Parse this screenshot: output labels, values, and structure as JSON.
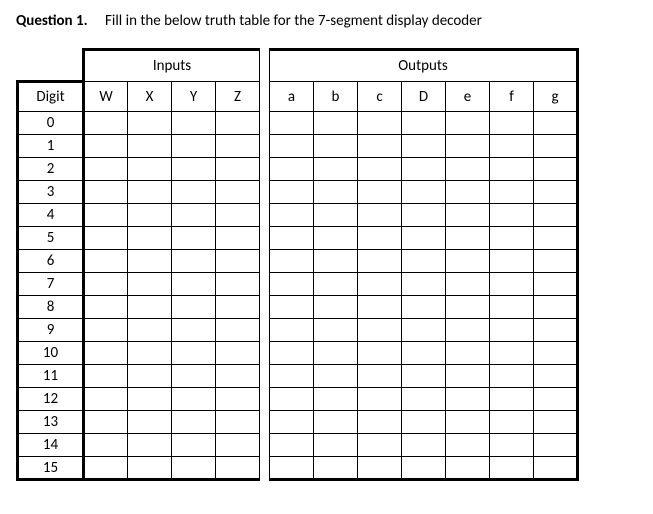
{
  "question": {
    "label": "Question 1.",
    "text": "Fill in the below truth table for the 7-segment display decoder"
  },
  "table": {
    "groups": {
      "inputs": "Inputs",
      "outputs": "Outputs"
    },
    "digit_header": "Digit",
    "input_headers": [
      "W",
      "X",
      "Y",
      "Z"
    ],
    "output_headers": [
      "a",
      "b",
      "c",
      "D",
      "e",
      "f",
      "g"
    ],
    "rows": [
      {
        "digit": "0",
        "inputs": [
          "",
          "",
          "",
          ""
        ],
        "outputs": [
          "",
          "",
          "",
          "",
          "",
          "",
          ""
        ]
      },
      {
        "digit": "1",
        "inputs": [
          "",
          "",
          "",
          ""
        ],
        "outputs": [
          "",
          "",
          "",
          "",
          "",
          "",
          ""
        ]
      },
      {
        "digit": "2",
        "inputs": [
          "",
          "",
          "",
          ""
        ],
        "outputs": [
          "",
          "",
          "",
          "",
          "",
          "",
          ""
        ]
      },
      {
        "digit": "3",
        "inputs": [
          "",
          "",
          "",
          ""
        ],
        "outputs": [
          "",
          "",
          "",
          "",
          "",
          "",
          ""
        ]
      },
      {
        "digit": "4",
        "inputs": [
          "",
          "",
          "",
          ""
        ],
        "outputs": [
          "",
          "",
          "",
          "",
          "",
          "",
          ""
        ]
      },
      {
        "digit": "5",
        "inputs": [
          "",
          "",
          "",
          ""
        ],
        "outputs": [
          "",
          "",
          "",
          "",
          "",
          "",
          ""
        ]
      },
      {
        "digit": "6",
        "inputs": [
          "",
          "",
          "",
          ""
        ],
        "outputs": [
          "",
          "",
          "",
          "",
          "",
          "",
          ""
        ]
      },
      {
        "digit": "7",
        "inputs": [
          "",
          "",
          "",
          ""
        ],
        "outputs": [
          "",
          "",
          "",
          "",
          "",
          "",
          ""
        ]
      },
      {
        "digit": "8",
        "inputs": [
          "",
          "",
          "",
          ""
        ],
        "outputs": [
          "",
          "",
          "",
          "",
          "",
          "",
          ""
        ]
      },
      {
        "digit": "9",
        "inputs": [
          "",
          "",
          "",
          ""
        ],
        "outputs": [
          "",
          "",
          "",
          "",
          "",
          "",
          ""
        ]
      },
      {
        "digit": "10",
        "inputs": [
          "",
          "",
          "",
          ""
        ],
        "outputs": [
          "",
          "",
          "",
          "",
          "",
          "",
          ""
        ]
      },
      {
        "digit": "11",
        "inputs": [
          "",
          "",
          "",
          ""
        ],
        "outputs": [
          "",
          "",
          "",
          "",
          "",
          "",
          ""
        ]
      },
      {
        "digit": "12",
        "inputs": [
          "",
          "",
          "",
          ""
        ],
        "outputs": [
          "",
          "",
          "",
          "",
          "",
          "",
          ""
        ]
      },
      {
        "digit": "13",
        "inputs": [
          "",
          "",
          "",
          ""
        ],
        "outputs": [
          "",
          "",
          "",
          "",
          "",
          "",
          ""
        ]
      },
      {
        "digit": "14",
        "inputs": [
          "",
          "",
          "",
          ""
        ],
        "outputs": [
          "",
          "",
          "",
          "",
          "",
          "",
          ""
        ]
      },
      {
        "digit": "15",
        "inputs": [
          "",
          "",
          "",
          ""
        ],
        "outputs": [
          "",
          "",
          "",
          "",
          "",
          "",
          ""
        ]
      }
    ]
  }
}
